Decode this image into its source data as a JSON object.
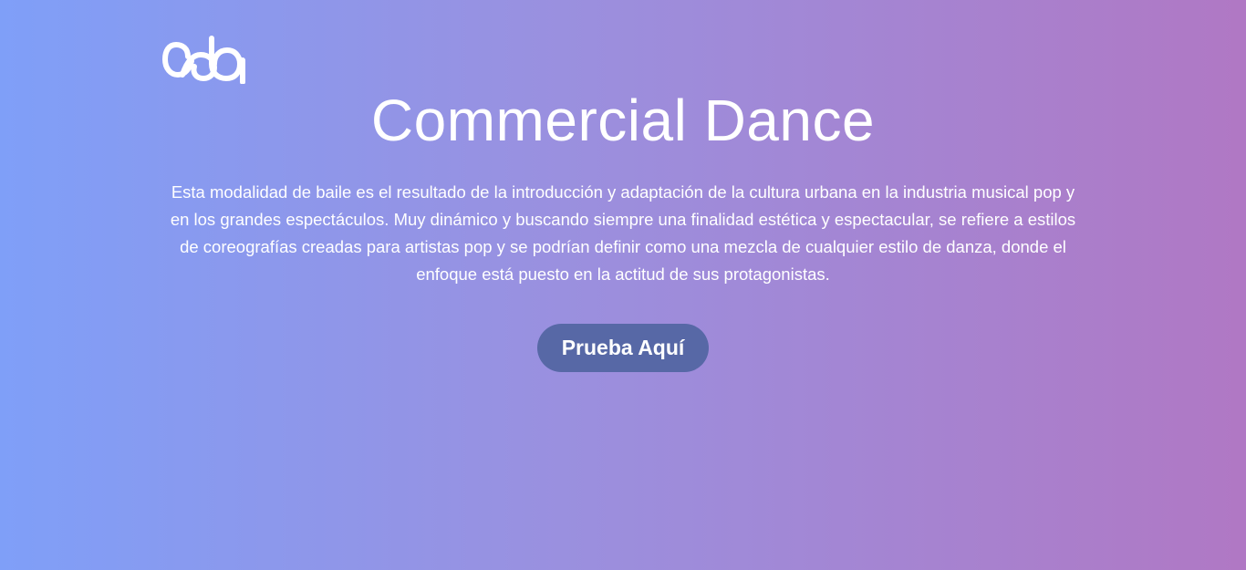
{
  "brand": {
    "logo_icon": "acda-logo-icon"
  },
  "hero": {
    "title": "Commercial Dance",
    "description": "Esta modalidad de baile es el resultado de la introducción y adaptación de la cultura urbana en la industria musical pop y en los grandes espectáculos. Muy dinámico y buscando siempre una finalidad estética y espectacular, se refiere a estilos de coreografías creadas para artistas pop y se podrían definir como una mezcla de cualquier estilo de danza, donde el enfoque está puesto en la actitud de sus protagonistas.",
    "cta_label": "Prueba Aquí"
  },
  "colors": {
    "gradient_start": "#7f9ff8",
    "gradient_mid": "#9a90df",
    "gradient_end": "#b078c4",
    "button_bg": "#5768a6",
    "text": "#ffffff"
  }
}
